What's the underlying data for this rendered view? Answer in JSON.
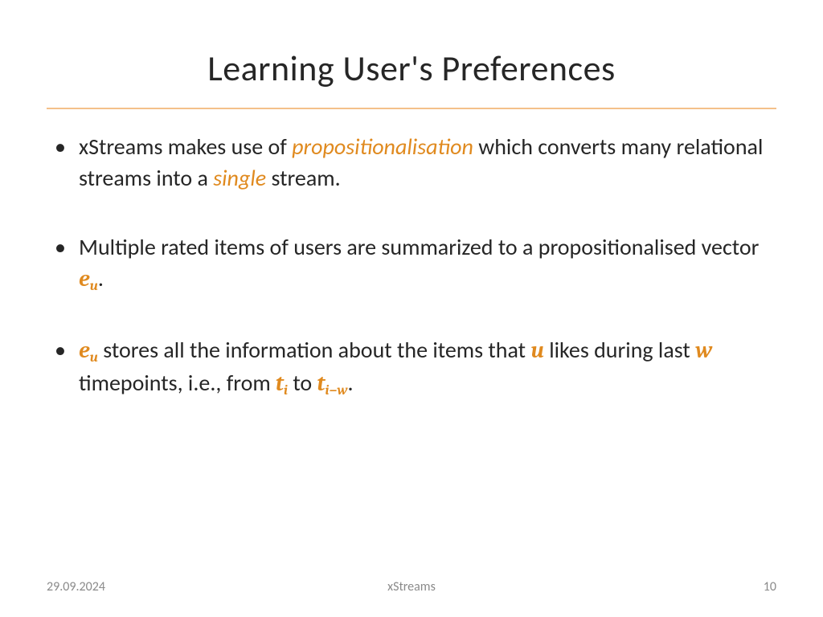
{
  "title": "Learning User's Preferences",
  "bullets": {
    "b1_a": "xStreams makes use of ",
    "b1_b": "propositionalisation",
    "b1_c": " which converts many relational streams into a ",
    "b1_d": "single",
    "b1_e": " stream.",
    "b2_a": "Multiple rated items of users are summarized to a propositionalised vector ",
    "b2_math_e": "e",
    "b2_math_u": "u",
    "b2_b": ".",
    "b3_math1_e": "e",
    "b3_math1_u": "u",
    "b3_a": " stores all the information about the items that ",
    "b3_math_u": "u",
    "b3_b": " likes during last ",
    "b3_math_w": "w",
    "b3_c": " timepoints, i.e., from ",
    "b3_math_t1": "t",
    "b3_math_i": "i",
    "b3_d": " to ",
    "b3_math_t2": "t",
    "b3_math_iw": "i−w",
    "b3_e": "."
  },
  "footer": {
    "date": "29.09.2024",
    "center": "xStreams",
    "page": "10"
  }
}
